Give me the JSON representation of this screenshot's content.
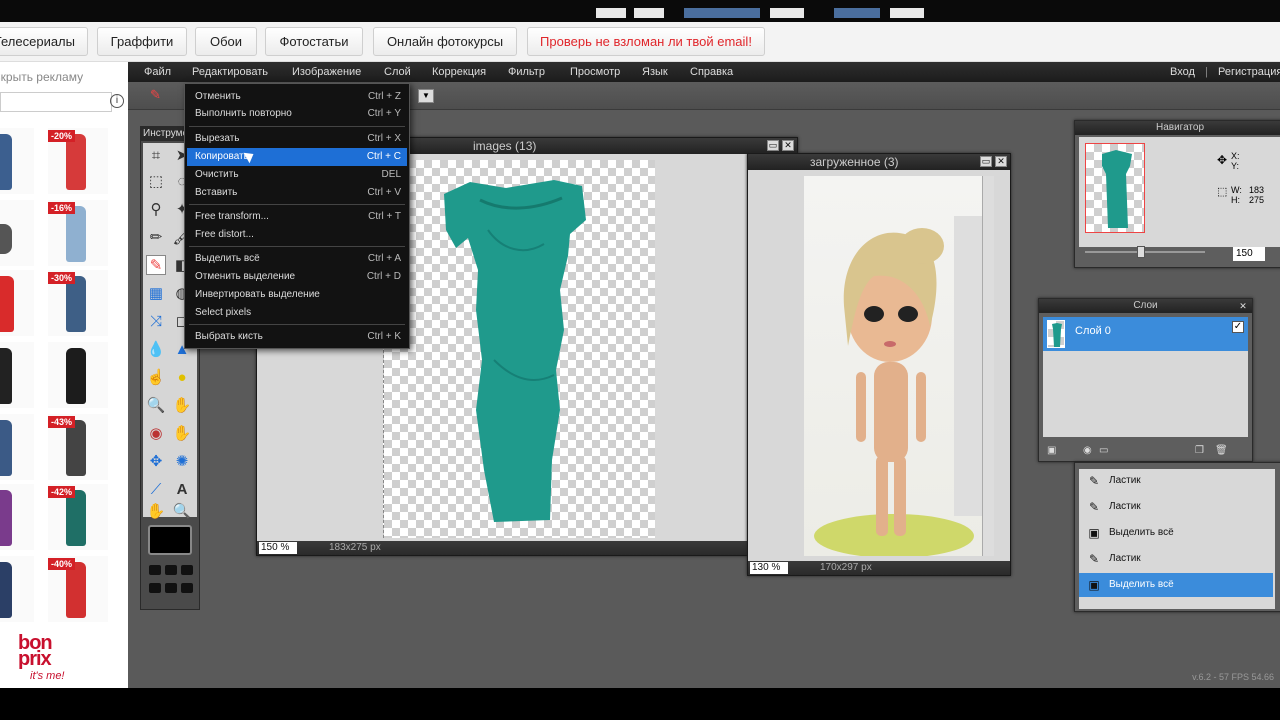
{
  "site_nav": {
    "items": [
      "Телесериалы",
      "Граффити",
      "Обои",
      "Фотостатьи",
      "Онлайн фотокурсы",
      "Проверь не взломан ли твой email!"
    ]
  },
  "ad": {
    "hide_label": "Скрыть рекламу",
    "info_glyph": "i",
    "badges": [
      "-20%",
      "-16%",
      "-30%",
      "-43%",
      "-42%",
      "-40%"
    ],
    "brand_line1": "bon",
    "brand_line2": "prix",
    "brand_tagline": "it's me!"
  },
  "menubar": {
    "items": [
      "Файл",
      "Редактировать",
      "Изображение",
      "Слой",
      "Коррекция",
      "Фильтр",
      "Просмотр",
      "Язык",
      "Справка"
    ],
    "login": "Вход",
    "separator": "|",
    "register": "Регистрация"
  },
  "tools_panel": {
    "title": "Инструменты"
  },
  "edit_menu": {
    "items": [
      {
        "label": "Отменить",
        "shortcut": "Ctrl + Z"
      },
      {
        "label": "Выполнить повторно",
        "shortcut": "Ctrl + Y"
      },
      {
        "label": "Вырезать",
        "shortcut": "Ctrl + X"
      },
      {
        "label": "Копировать",
        "shortcut": "Ctrl + C"
      },
      {
        "label": "Очистить",
        "shortcut": "DEL"
      },
      {
        "label": "Вставить",
        "shortcut": "Ctrl + V"
      },
      {
        "label": "Free transform...",
        "shortcut": "Ctrl + T"
      },
      {
        "label": "Free distort...",
        "shortcut": ""
      },
      {
        "label": "Выделить всё",
        "shortcut": "Ctrl + A"
      },
      {
        "label": "Отменить выделение",
        "shortcut": "Ctrl + D"
      },
      {
        "label": "Инвертировать выделение",
        "shortcut": ""
      },
      {
        "label": "Select pixels",
        "shortcut": ""
      },
      {
        "label": "Выбрать кисть",
        "shortcut": "Ctrl + K"
      }
    ]
  },
  "doc1": {
    "title": "images (13)",
    "zoom": "150 %",
    "dims": "183x275 px"
  },
  "doc2": {
    "title": "загруженное (3)",
    "zoom": "130 %",
    "dims": "170x297 px"
  },
  "navigator": {
    "title": "Навигатор",
    "x_label": "X:",
    "y_label": "Y:",
    "w_label": "W:",
    "w_value": "183",
    "h_label": "H:",
    "h_value": "275",
    "zoom": "150"
  },
  "layers": {
    "title": "Слои",
    "layer_name": "Слой 0"
  },
  "history": {
    "items": [
      "Ластик",
      "Ластик",
      "Выделить всё",
      "Ластик",
      "Выделить всё"
    ]
  },
  "status": "v.6.2 - 57 FPS 54.66",
  "colors": {
    "accent": "#1e6fd6",
    "dress": "#1f9a8c",
    "badge": "#d42026",
    "brand": "#c8102e"
  }
}
